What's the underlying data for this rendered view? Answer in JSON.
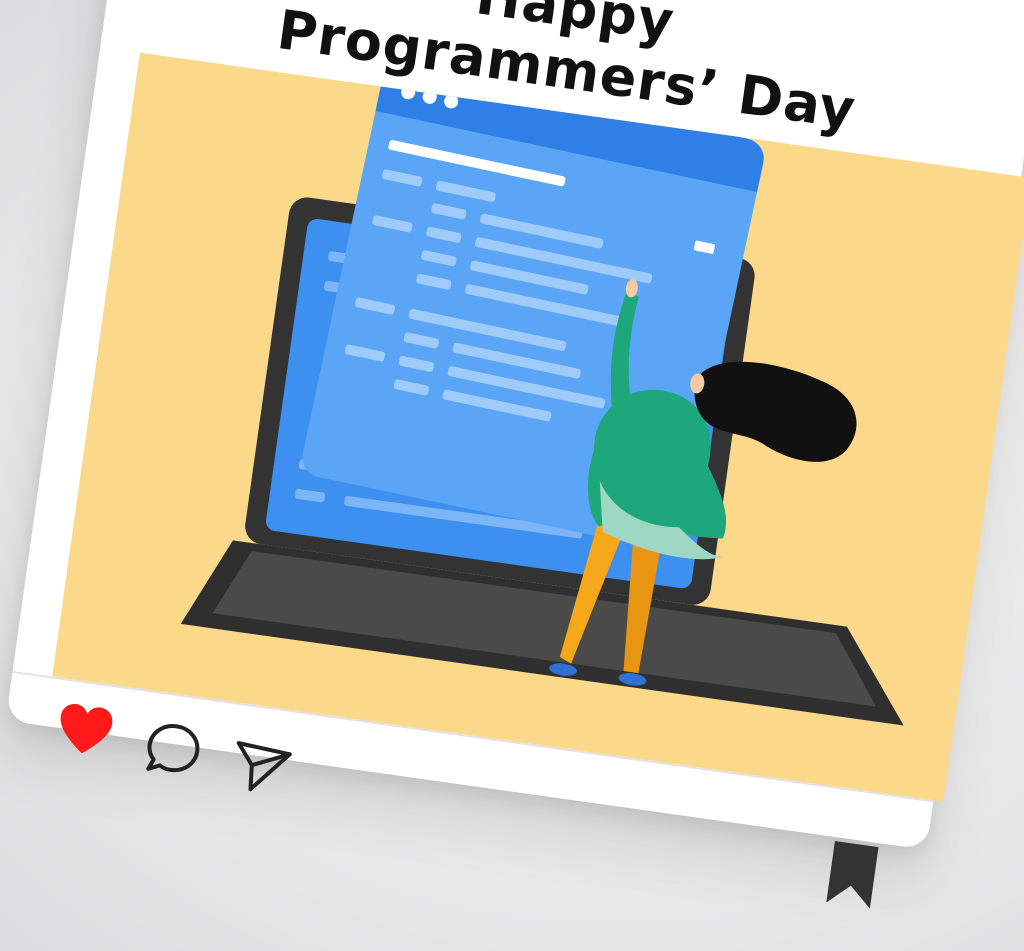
{
  "post": {
    "title_line1": "Happy",
    "title_line2": "Programmers’ Day"
  },
  "colors": {
    "background": "#e8e8e9",
    "card": "#ffffff",
    "photo_background": "#fcd88a",
    "heart": "#ff1a1a",
    "screen_blue": "#3d8ff0",
    "window_blue": "#5aa5f5",
    "laptop": "#3b3b3b",
    "sweater": "#1ea77a",
    "pants": "#f6a81a",
    "hair": "#111111",
    "bookmark": "#333333"
  },
  "actions": {
    "like": {
      "icon": "heart-icon",
      "state": "liked"
    },
    "comment": {
      "icon": "speech-bubble-icon"
    },
    "share": {
      "icon": "paper-plane-icon"
    },
    "save": {
      "icon": "bookmark-icon",
      "state": "saved"
    }
  }
}
